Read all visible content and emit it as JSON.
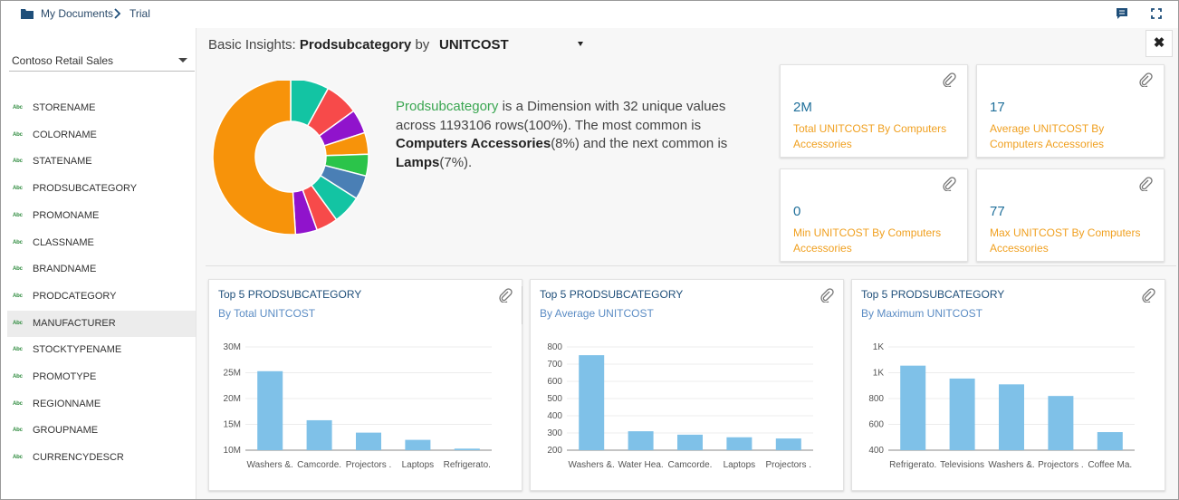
{
  "breadcrumb": {
    "root": "My Documents",
    "current": "Trial"
  },
  "sidebar": {
    "datasource": "Contoso Retail Sales",
    "type_badge": "Abc",
    "fields": [
      "STORENAME",
      "COLORNAME",
      "STATENAME",
      "PRODSUBCATEGORY",
      "PROMONAME",
      "CLASSNAME",
      "BRANDNAME",
      "PRODCATEGORY",
      "MANUFACTURER",
      "STOCKTYPENAME",
      "PROMOTYPE",
      "REGIONNAME",
      "GROUPNAME",
      "CURRENCYDESCR"
    ],
    "selected": "MANUFACTURER"
  },
  "insights": {
    "prefix": "Basic Insights:",
    "dimension": "Prodsubcategory",
    "by": "by",
    "measure": "UNITCOST",
    "close": "✖",
    "desc_dimension": "Prodsubcategory",
    "desc_1": " is a Dimension with 32 unique values across 1193106 rows(100%). The most common is ",
    "most_common": "Computers Accessories",
    "desc_2": "(8%) and the next common is ",
    "next_common": "Lamps",
    "desc_3": "(7%)."
  },
  "donut": {
    "slices": [
      {
        "value": 8,
        "color": "#13c4a3"
      },
      {
        "value": 7,
        "color": "#f74a4a"
      },
      {
        "value": 5,
        "color": "#9013cc"
      },
      {
        "value": 4.5,
        "color": "#f7930a"
      },
      {
        "value": 4.5,
        "color": "#2bc44a"
      },
      {
        "value": 5,
        "color": "#4a7fb5"
      },
      {
        "value": 6,
        "color": "#13c4a3"
      },
      {
        "value": 4.5,
        "color": "#f74a4a"
      },
      {
        "value": 4.5,
        "color": "#9013cc"
      },
      {
        "value": 51,
        "color": "#f7930a"
      }
    ]
  },
  "kpis": [
    {
      "value": "2M",
      "label": "Total UNITCOST By Computers Accessories"
    },
    {
      "value": "17",
      "label": "Average UNITCOST By Computers Accessories"
    },
    {
      "value": "0",
      "label": "Min UNITCOST By Computers Accessories"
    },
    {
      "value": "77",
      "label": "Max UNITCOST By Computers Accessories"
    }
  ],
  "chart_data": [
    {
      "type": "bar",
      "title": "Top 5 PRODSUBCATEGORY",
      "subtitle": "By Total UNITCOST",
      "categories": [
        "Washers &.",
        "Camcorde.",
        "Projectors .",
        "Laptops",
        "Refrigerato."
      ],
      "values": [
        25.3,
        15.8,
        13.4,
        12.0,
        10.3
      ],
      "ylim": [
        10,
        30
      ],
      "yticks": [
        10,
        15,
        20,
        25,
        30
      ],
      "ytick_labels": [
        "10M",
        "15M",
        "20M",
        "25M",
        "30M"
      ],
      "color": "#7fc1e8"
    },
    {
      "type": "bar",
      "title": "Top 5 PRODSUBCATEGORY",
      "subtitle": "By Average UNITCOST",
      "categories": [
        "Washers &.",
        "Water Hea.",
        "Camcorde.",
        "Laptops",
        "Projectors ."
      ],
      "values": [
        752,
        310,
        290,
        275,
        268
      ],
      "ylim": [
        200,
        800
      ],
      "yticks": [
        200,
        300,
        400,
        500,
        600,
        700,
        800
      ],
      "ytick_labels": [
        "200",
        "300",
        "400",
        "500",
        "600",
        "700",
        "800"
      ],
      "color": "#7fc1e8"
    },
    {
      "type": "bar",
      "title": "Top 5 PRODSUBCATEGORY",
      "subtitle": "By Maximum UNITCOST",
      "categories": [
        "Refrigerato.",
        "Televisions",
        "Washers &.",
        "Projectors .",
        "Coffee Ma."
      ],
      "values": [
        1055,
        955,
        910,
        820,
        540
      ],
      "ylim": [
        400,
        1200
      ],
      "yticks": [
        400,
        600,
        800,
        1000,
        1200
      ],
      "ytick_labels": [
        "400",
        "600",
        "800",
        "1K",
        "1K"
      ],
      "color": "#7fc1e8"
    }
  ]
}
